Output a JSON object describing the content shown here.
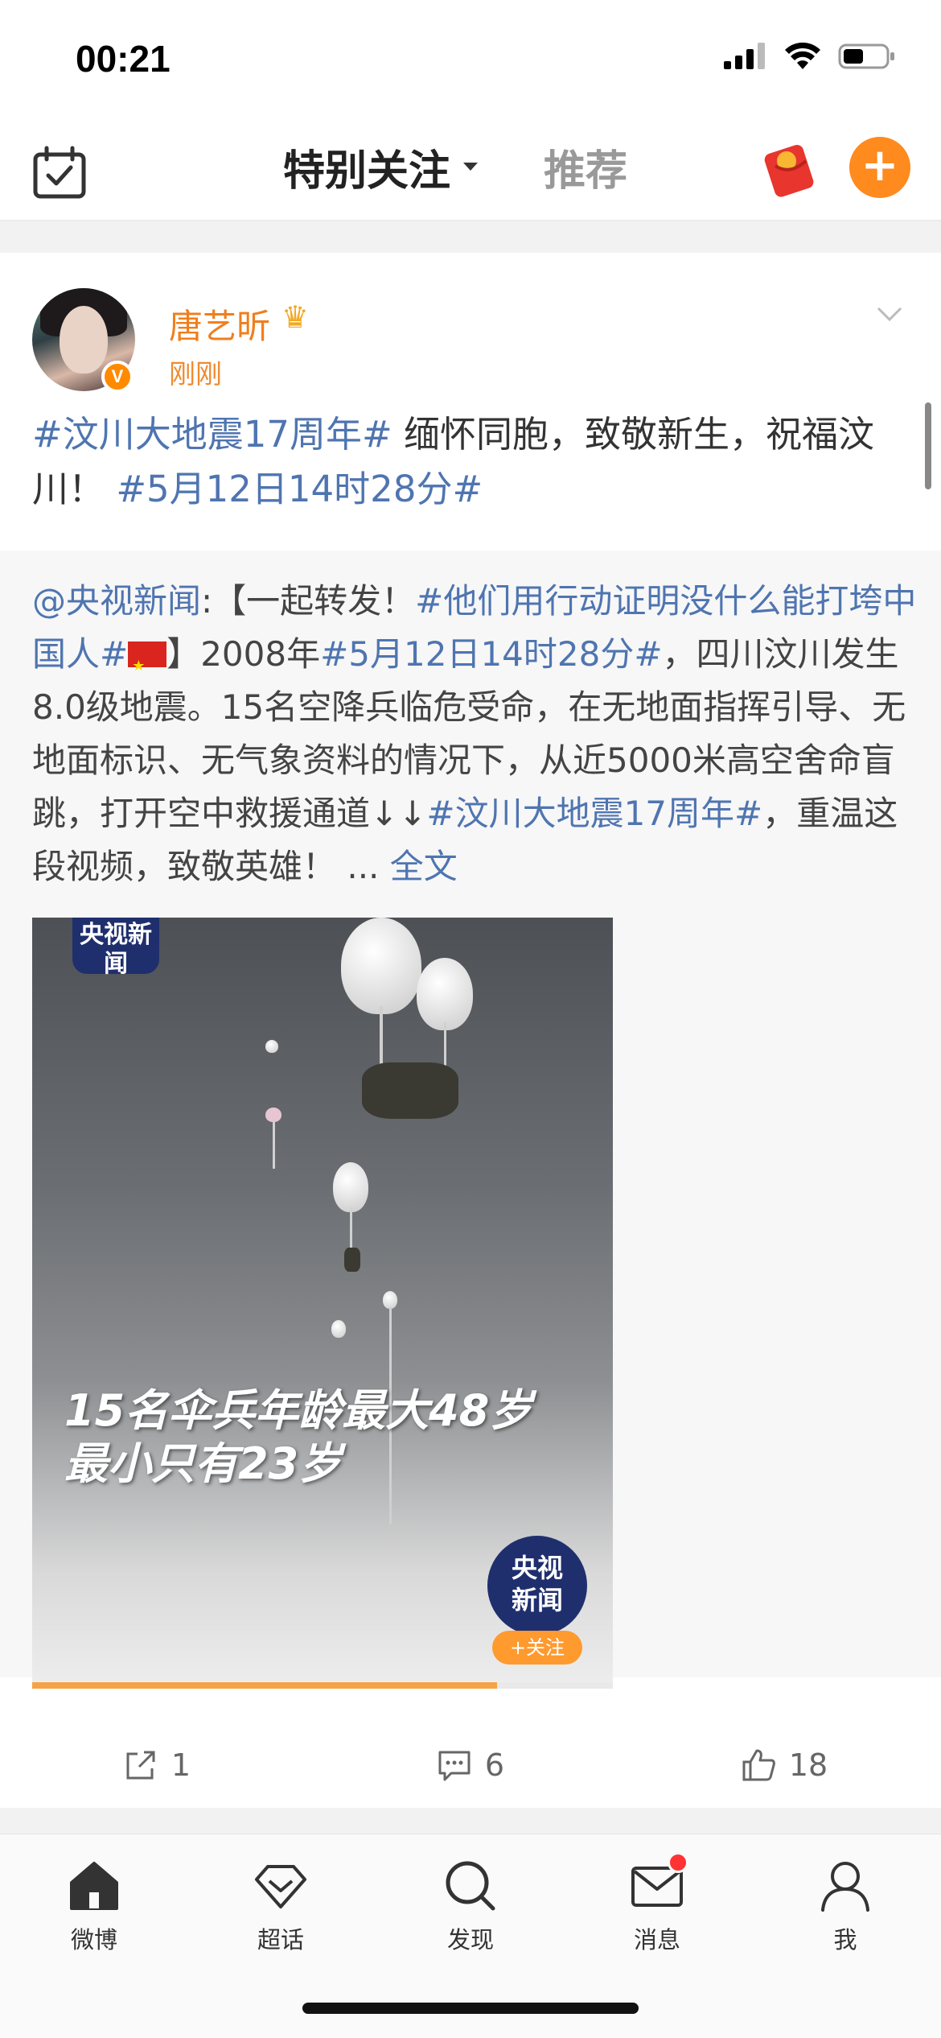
{
  "status_bar": {
    "time": "00:21"
  },
  "header": {
    "tab_active": "特别关注",
    "tab_recommend": "推荐",
    "accent_color": "#ff8a1e"
  },
  "post": {
    "author": "唐艺昕",
    "time": "刚刚",
    "text_topic1": "#汶川大地震17周年#",
    "text_body": " 缅怀同胞，致敬新生，祝福汶川！",
    "text_topic2": "#5月12日14时28分#"
  },
  "repost": {
    "mention": "@央视新闻",
    "colon_bracket": ":【一起转发！",
    "topic_a": "#他们用行动证明没什么能打垮中国人#",
    "bracket_close": "】2008年",
    "topic_b": "#5月12日14时28分#",
    "body1": "，四川汶川发生8.0级地震。15名空降兵临危受命，在无地面指挥引导、无地面标识、无气象资料的情况下，从近5000米高空舍命盲跳，打开空中救援通道↓↓",
    "topic_c": "#汶川大地震17周年#",
    "body2": "，重温这段视频，致敬英雄！ ... ",
    "full_text_link": "全文",
    "video": {
      "logo_text": "央视新闻",
      "caption_line1": "15名伞兵年龄最大48岁",
      "caption_line2": "最小只有23岁",
      "channel_logo_line1": "央视",
      "channel_logo_line2": "新闻",
      "follow_label": "+关注",
      "progress_fraction": 0.8
    }
  },
  "actions": {
    "repost_count": "1",
    "comment_count": "6",
    "like_count": "18"
  },
  "tabbar": {
    "home": "微博",
    "super_topic": "超话",
    "discover": "发现",
    "messages": "消息",
    "me": "我"
  }
}
